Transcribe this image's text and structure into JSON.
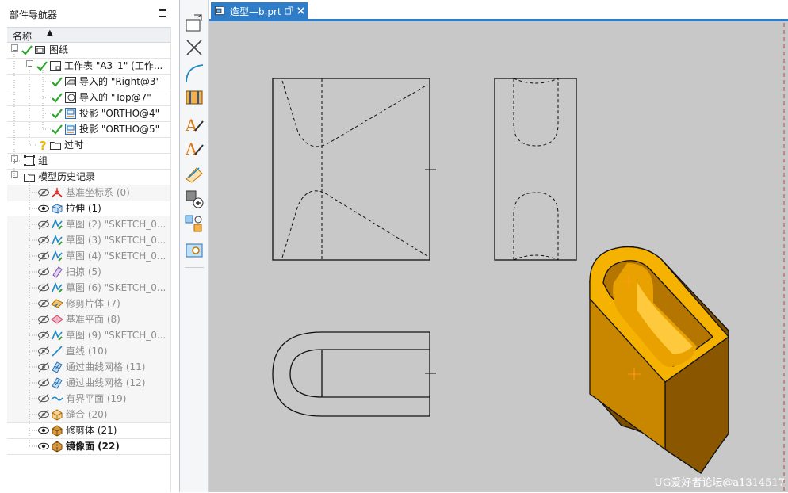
{
  "navigator": {
    "title": "部件导航器",
    "column_name": "名称",
    "rows": [
      {
        "label": "图纸",
        "style": "normal"
      },
      {
        "label": "工作表 \"A3_1\" (工作...",
        "style": "normal"
      },
      {
        "label": "导入的 \"Right@3\"",
        "style": "normal"
      },
      {
        "label": "导入的 \"Top@7\"",
        "style": "normal"
      },
      {
        "label": "投影 \"ORTHO@4\"",
        "style": "normal"
      },
      {
        "label": "投影 \"ORTHO@5\"",
        "style": "normal"
      },
      {
        "label": "过时",
        "style": "normal"
      },
      {
        "label": "组",
        "style": "normal"
      },
      {
        "label": "模型历史记录",
        "style": "normal"
      },
      {
        "label": "基准坐标系 (0)",
        "style": "gray"
      },
      {
        "label": "拉伸 (1)",
        "style": "normal"
      },
      {
        "label": "草图 (2) \"SKETCH_0...",
        "style": "gray"
      },
      {
        "label": "草图 (3) \"SKETCH_0...",
        "style": "gray"
      },
      {
        "label": "草图 (4) \"SKETCH_0...",
        "style": "gray"
      },
      {
        "label": "扫掠 (5)",
        "style": "gray"
      },
      {
        "label": "草图 (6) \"SKETCH_0...",
        "style": "gray"
      },
      {
        "label": "修剪片体 (7)",
        "style": "gray"
      },
      {
        "label": "基准平面 (8)",
        "style": "gray"
      },
      {
        "label": "草图 (9) \"SKETCH_0...",
        "style": "gray"
      },
      {
        "label": "直线 (10)",
        "style": "gray"
      },
      {
        "label": "通过曲线网格 (11)",
        "style": "gray"
      },
      {
        "label": "通过曲线网格 (12)",
        "style": "gray"
      },
      {
        "label": "有界平面 (19)",
        "style": "gray"
      },
      {
        "label": "缝合 (20)",
        "style": "gray"
      },
      {
        "label": "修剪体 (21)",
        "style": "normal"
      },
      {
        "label": "镜像面 (22)",
        "style": "bold"
      }
    ]
  },
  "toolbar": {
    "icons": [
      "new-sheet-icon",
      "delete-icon",
      "arc-icon",
      "section-icon",
      "text-annotation-icon",
      "text-annotation-2-icon",
      "edit-sketch-icon",
      "add-component-icon",
      "pattern-icon",
      "view-icon"
    ]
  },
  "tab": {
    "label": "造型—b.prt"
  },
  "watermark": "UG爱好者论坛@a1314517",
  "colors": {
    "accent": "#2f7dc8",
    "canvas": "#c8c8c8",
    "solid_fill": "#c98700",
    "check": "#2aa82a"
  }
}
